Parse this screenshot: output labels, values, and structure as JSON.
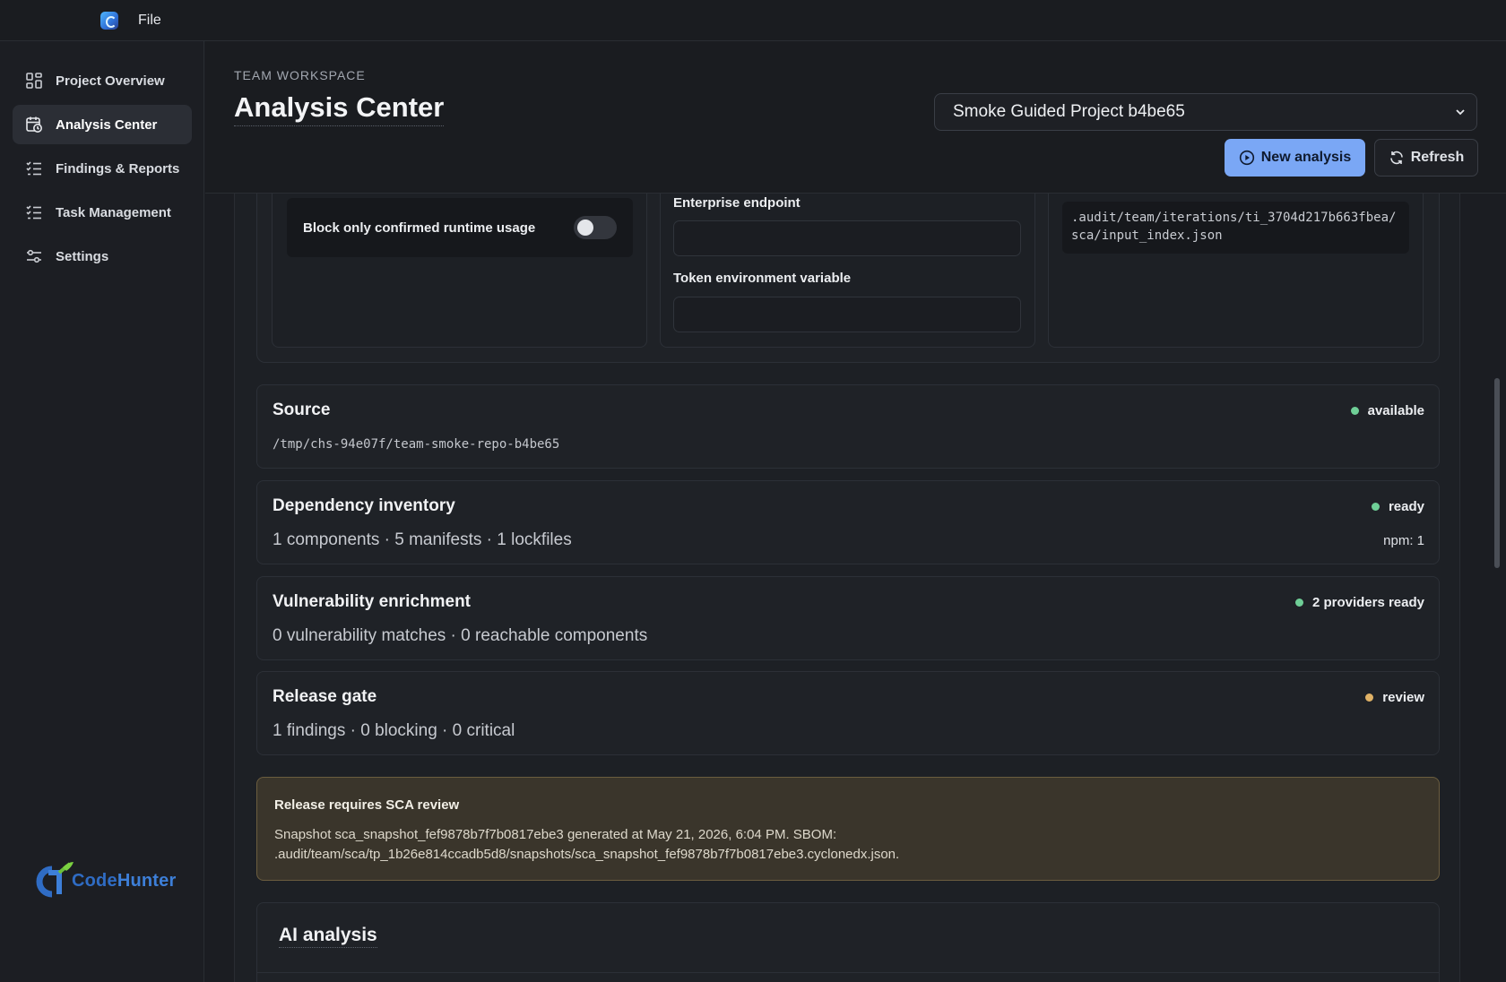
{
  "menubar": {
    "file": "File",
    "app_icon": "codehunter-app-icon"
  },
  "sidebar": {
    "items": [
      {
        "label": "Project Overview",
        "icon": "dashboard-grid-icon",
        "active": false
      },
      {
        "label": "Analysis Center",
        "icon": "calendar-clock-icon",
        "active": true
      },
      {
        "label": "Findings & Reports",
        "icon": "checklist-icon",
        "active": false
      },
      {
        "label": "Task Management",
        "icon": "checklist-icon",
        "active": false
      },
      {
        "label": "Settings",
        "icon": "sliders-icon",
        "active": false
      }
    ],
    "logo": {
      "prefix": "Code",
      "suffix": "Hunter"
    }
  },
  "header": {
    "eyebrow": "TEAM WORKSPACE",
    "title": "Analysis Center",
    "project_select": "Smoke Guided Project b4be65",
    "new_analysis": "New analysis",
    "refresh": "Refresh"
  },
  "settings": {
    "toggle_label": "Block only confirmed runtime usage",
    "toggle_on": false,
    "enterprise_endpoint_label": "Enterprise endpoint",
    "enterprise_endpoint_value": "",
    "token_env_label": "Token environment variable",
    "token_env_value": "",
    "input_index_path": ".audit/team/iterations/ti_3704d217b663fbea/\nsca/input_index.json"
  },
  "status_cards": [
    {
      "title": "Source",
      "subtitle": "/tmp/chs-94e07f/team-smoke-repo-b4be65",
      "status": "available",
      "status_color": "#6fcf97",
      "extra": ""
    },
    {
      "title": "Dependency inventory",
      "subtitle": "1 components · 5 manifests · 1 lockfiles",
      "status": "ready",
      "status_color": "#6fcf97",
      "extra": "npm: 1"
    },
    {
      "title": "Vulnerability enrichment",
      "subtitle": "0 vulnerability matches · 0 reachable components",
      "status": "2 providers ready",
      "status_color": "#6fcf97",
      "extra": ""
    },
    {
      "title": "Release gate",
      "subtitle": "1 findings · 0 blocking · 0 critical",
      "status": "review",
      "status_color": "#e0b266",
      "extra": ""
    }
  ],
  "alert": {
    "title": "Release requires SCA review",
    "line1": "Snapshot sca_snapshot_fef9878b7f7b0817ebe3 generated at May 21, 2026, 6:04 PM. SBOM:",
    "line2": ".audit/team/sca/tp_1b26e814ccadb5d8/snapshots/sca_snapshot_fef9878b7f7b0817ebe3.cyclonedx.json."
  },
  "ai": {
    "title": "AI analysis"
  }
}
